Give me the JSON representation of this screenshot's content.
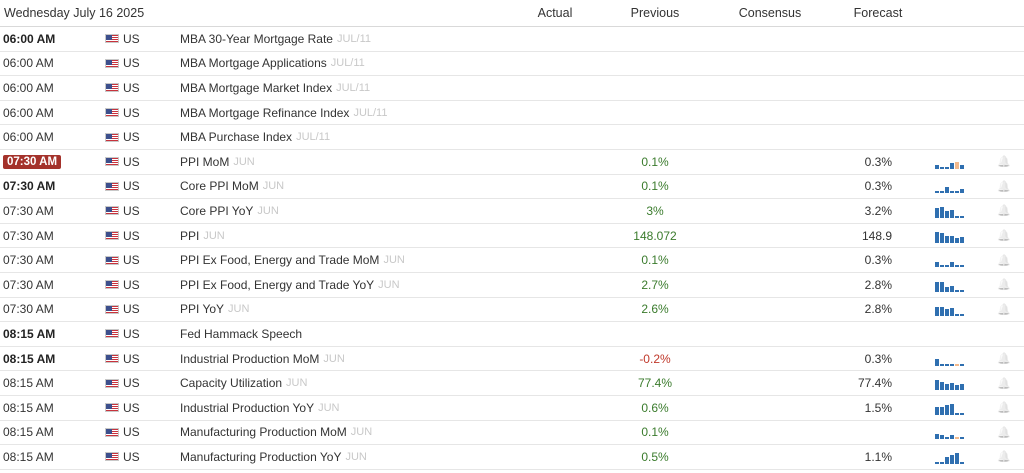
{
  "header": {
    "date": "Wednesday July 16 2025",
    "actual": "Actual",
    "previous": "Previous",
    "consensus": "Consensus",
    "forecast": "Forecast"
  },
  "colors": {
    "positive": "#3a7b2c",
    "negative": "#c0392b",
    "live_badge": "#a4322b",
    "spark": "#2f6fb0"
  },
  "icons": {
    "flag": "us-flag-icon",
    "bell": "bell-icon",
    "spark": "sparkline-chart"
  },
  "rows": [
    {
      "time": "06:00 AM",
      "bold": true,
      "live": false,
      "country": "US",
      "event": "MBA 30-Year Mortgage Rate",
      "ref": "JUL/11",
      "actual": "",
      "previous": "",
      "prev_sign": "",
      "consensus": "",
      "forecast": "",
      "spark": []
    },
    {
      "time": "06:00 AM",
      "bold": false,
      "live": false,
      "country": "US",
      "event": "MBA Mortgage Applications",
      "ref": "JUL/11",
      "actual": "",
      "previous": "",
      "prev_sign": "",
      "consensus": "",
      "forecast": "",
      "spark": []
    },
    {
      "time": "06:00 AM",
      "bold": false,
      "live": false,
      "country": "US",
      "event": "MBA Mortgage Market Index",
      "ref": "JUL/11",
      "actual": "",
      "previous": "",
      "prev_sign": "",
      "consensus": "",
      "forecast": "",
      "spark": []
    },
    {
      "time": "06:00 AM",
      "bold": false,
      "live": false,
      "country": "US",
      "event": "MBA Mortgage Refinance Index",
      "ref": "JUL/11",
      "actual": "",
      "previous": "",
      "prev_sign": "",
      "consensus": "",
      "forecast": "",
      "spark": []
    },
    {
      "time": "06:00 AM",
      "bold": false,
      "live": false,
      "country": "US",
      "event": "MBA Purchase Index",
      "ref": "JUL/11",
      "actual": "",
      "previous": "",
      "prev_sign": "",
      "consensus": "",
      "forecast": "",
      "spark": []
    },
    {
      "time": "07:30 AM",
      "bold": true,
      "live": true,
      "country": "US",
      "event": "PPI MoM",
      "ref": "JUN",
      "actual": "",
      "previous": "0.1%",
      "prev_sign": "pos",
      "consensus": "",
      "forecast": "0.3%",
      "spark": [
        0.35,
        0.2,
        0.15,
        0.5,
        "f0.6",
        0.35
      ]
    },
    {
      "time": "07:30 AM",
      "bold": true,
      "live": false,
      "country": "US",
      "event": "Core PPI MoM",
      "ref": "JUN",
      "actual": "",
      "previous": "0.1%",
      "prev_sign": "pos",
      "consensus": "",
      "forecast": "0.3%",
      "spark": [
        0.2,
        0.15,
        0.5,
        0.1,
        0.2,
        0.3
      ]
    },
    {
      "time": "07:30 AM",
      "bold": false,
      "live": false,
      "country": "US",
      "event": "Core PPI YoY",
      "ref": "JUN",
      "actual": "",
      "previous": "3%",
      "prev_sign": "pos",
      "consensus": "",
      "forecast": "3.2%",
      "spark": [
        0.8,
        0.9,
        0.6,
        0.7,
        0.2,
        0.2
      ]
    },
    {
      "time": "07:30 AM",
      "bold": false,
      "live": false,
      "country": "US",
      "event": "PPI",
      "ref": "JUN",
      "actual": "",
      "previous": "148.072",
      "prev_sign": "pos",
      "consensus": "",
      "forecast": "148.9",
      "spark": [
        0.9,
        0.85,
        0.6,
        0.6,
        0.4,
        0.5
      ]
    },
    {
      "time": "07:30 AM",
      "bold": false,
      "live": false,
      "country": "US",
      "event": "PPI Ex Food, Energy and Trade MoM",
      "ref": "JUN",
      "actual": "",
      "previous": "0.1%",
      "prev_sign": "pos",
      "consensus": "",
      "forecast": "0.3%",
      "spark": [
        0.4,
        0.2,
        0.15,
        0.4,
        0.1,
        0.2
      ]
    },
    {
      "time": "07:30 AM",
      "bold": false,
      "live": false,
      "country": "US",
      "event": "PPI Ex Food, Energy and Trade YoY",
      "ref": "JUN",
      "actual": "",
      "previous": "2.7%",
      "prev_sign": "pos",
      "consensus": "",
      "forecast": "2.8%",
      "spark": [
        0.8,
        0.8,
        0.45,
        0.5,
        0.1,
        0.15
      ]
    },
    {
      "time": "07:30 AM",
      "bold": false,
      "live": false,
      "country": "US",
      "event": "PPI YoY",
      "ref": "JUN",
      "actual": "",
      "previous": "2.6%",
      "prev_sign": "pos",
      "consensus": "",
      "forecast": "2.8%",
      "spark": [
        0.75,
        0.75,
        0.6,
        0.65,
        0.1,
        0.1
      ]
    },
    {
      "time": "08:15 AM",
      "bold": true,
      "live": false,
      "country": "US",
      "event": "Fed Hammack Speech",
      "ref": "",
      "actual": "",
      "previous": "",
      "prev_sign": "",
      "consensus": "",
      "forecast": "",
      "spark": []
    },
    {
      "time": "08:15 AM",
      "bold": true,
      "live": false,
      "country": "US",
      "event": "Industrial Production MoM",
      "ref": "JUN",
      "actual": "",
      "previous": "-0.2%",
      "prev_sign": "neg",
      "consensus": "",
      "forecast": "0.3%",
      "spark": [
        0.6,
        0.2,
        0.1,
        0.1,
        "f0.15",
        0.1
      ]
    },
    {
      "time": "08:15 AM",
      "bold": false,
      "live": false,
      "country": "US",
      "event": "Capacity Utilization",
      "ref": "JUN",
      "actual": "",
      "previous": "77.4%",
      "prev_sign": "pos",
      "consensus": "",
      "forecast": "77.4%",
      "spark": [
        0.8,
        0.7,
        0.5,
        0.6,
        0.4,
        0.5
      ]
    },
    {
      "time": "08:15 AM",
      "bold": false,
      "live": false,
      "country": "US",
      "event": "Industrial Production YoY",
      "ref": "JUN",
      "actual": "",
      "previous": "0.6%",
      "prev_sign": "pos",
      "consensus": "",
      "forecast": "1.5%",
      "spark": [
        0.7,
        0.7,
        0.85,
        0.9,
        0.2,
        0.15
      ]
    },
    {
      "time": "08:15 AM",
      "bold": false,
      "live": false,
      "country": "US",
      "event": "Manufacturing Production MoM",
      "ref": "JUN",
      "actual": "",
      "previous": "0.1%",
      "prev_sign": "pos",
      "consensus": "",
      "forecast": "",
      "spark": [
        0.45,
        0.35,
        0.2,
        0.3,
        "f0.2",
        0.1
      ]
    },
    {
      "time": "08:15 AM",
      "bold": false,
      "live": false,
      "country": "US",
      "event": "Manufacturing Production YoY",
      "ref": "JUN",
      "actual": "",
      "previous": "0.5%",
      "prev_sign": "pos",
      "consensus": "",
      "forecast": "1.1%",
      "spark": [
        0.2,
        0.2,
        0.6,
        0.75,
        0.9,
        0.1
      ]
    }
  ]
}
